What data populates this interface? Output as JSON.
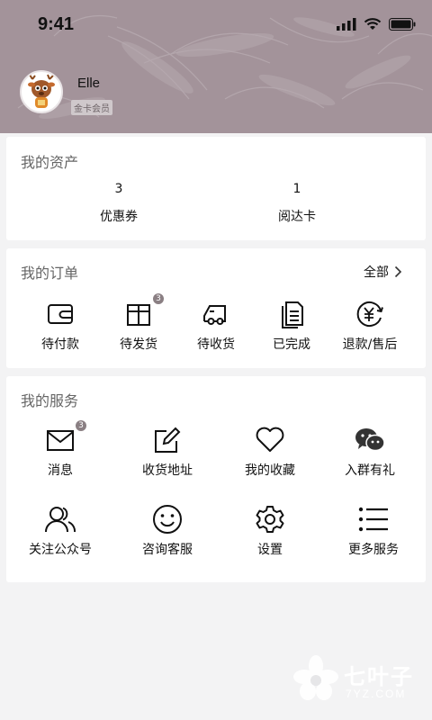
{
  "status_bar": {
    "time": "9:41"
  },
  "profile": {
    "username": "Elle",
    "member_level": "金卡会员"
  },
  "assets": {
    "title": "我的资产",
    "items": [
      {
        "value": "3",
        "label": "优惠券"
      },
      {
        "value": "1",
        "label": "阅达卡"
      }
    ]
  },
  "orders": {
    "title": "我的订单",
    "all_label": "全部",
    "items": [
      {
        "label": "待付款",
        "icon": "wallet-icon"
      },
      {
        "label": "待发货",
        "icon": "package-icon",
        "badge": "3"
      },
      {
        "label": "待收货",
        "icon": "truck-icon"
      },
      {
        "label": "已完成",
        "icon": "document-icon"
      },
      {
        "label": "退款/售后",
        "icon": "refund-icon"
      }
    ]
  },
  "services": {
    "title": "我的服务",
    "items": [
      {
        "label": "消息",
        "icon": "mail-icon",
        "badge": "3"
      },
      {
        "label": "收货地址",
        "icon": "edit-icon"
      },
      {
        "label": "我的收藏",
        "icon": "heart-icon"
      },
      {
        "label": "入群有礼",
        "icon": "wechat-icon"
      },
      {
        "label": "关注公众号",
        "icon": "users-icon"
      },
      {
        "label": "咨询客服",
        "icon": "smile-icon"
      },
      {
        "label": "设置",
        "icon": "gear-icon"
      },
      {
        "label": "更多服务",
        "icon": "list-icon"
      }
    ]
  },
  "watermark": {
    "name": "七叶子",
    "domain": "7YZ.COM"
  }
}
